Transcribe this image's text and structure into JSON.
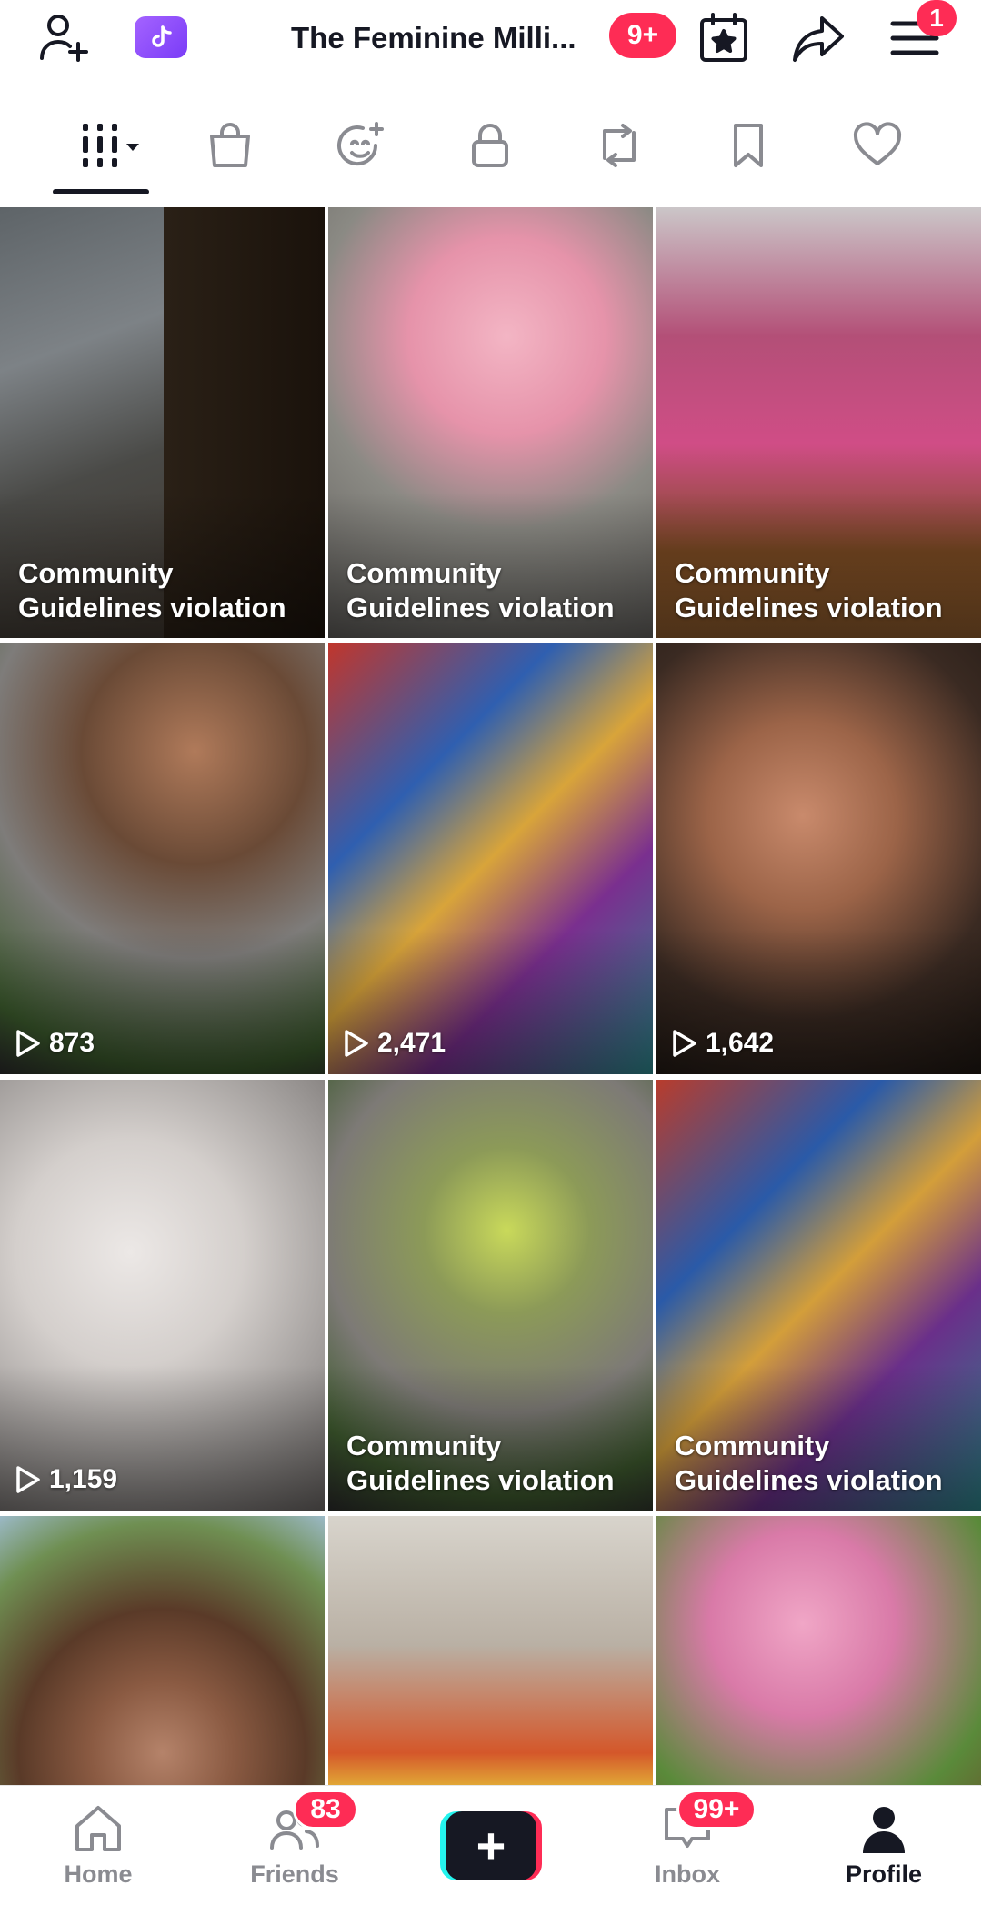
{
  "header": {
    "title": "The Feminine Milli...",
    "title_badge": "9+",
    "menu_badge": "1",
    "icons": [
      "add-friend-icon",
      "live-studio-icon",
      "calendar-star-icon",
      "share-icon",
      "menu-icon"
    ]
  },
  "tabs": [
    {
      "name": "videos",
      "icon": "grid-videos-icon",
      "active": true
    },
    {
      "name": "shop",
      "icon": "shopping-bag-icon",
      "active": false
    },
    {
      "name": "favorites-effects",
      "icon": "sparkle-face-icon",
      "active": false
    },
    {
      "name": "private",
      "icon": "lock-icon",
      "active": false
    },
    {
      "name": "reposts",
      "icon": "repost-icon",
      "active": false
    },
    {
      "name": "saved",
      "icon": "bookmark-icon",
      "active": false
    },
    {
      "name": "liked",
      "icon": "heart-icon",
      "active": false
    }
  ],
  "grid": {
    "violation_label": "Community Guidelines violation",
    "tiles": [
      {
        "kind": "violation"
      },
      {
        "kind": "violation"
      },
      {
        "kind": "violation"
      },
      {
        "kind": "views",
        "views": "873"
      },
      {
        "kind": "views",
        "views": "2,471"
      },
      {
        "kind": "views",
        "views": "1,642"
      },
      {
        "kind": "views",
        "views": "1,159"
      },
      {
        "kind": "violation"
      },
      {
        "kind": "violation"
      },
      {
        "kind": "partial"
      },
      {
        "kind": "partial"
      },
      {
        "kind": "partial"
      }
    ]
  },
  "bottom_nav": {
    "home": "Home",
    "friends": "Friends",
    "friends_badge": "83",
    "create": "+",
    "inbox": "Inbox",
    "inbox_badge": "99+",
    "profile": "Profile"
  },
  "colors": {
    "accent": "#fe2c55",
    "cyan": "#25f4ee",
    "text": "#161823",
    "muted": "#8a8b91"
  }
}
